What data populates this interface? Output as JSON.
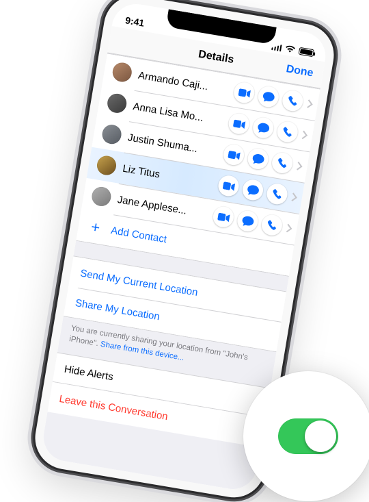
{
  "status": {
    "time": "9:41"
  },
  "nav": {
    "title": "Details",
    "done": "Done"
  },
  "contacts": [
    {
      "name": "Armando Caji...",
      "avatar": "c1",
      "highlight": false
    },
    {
      "name": "Anna Lisa Mo...",
      "avatar": "c2",
      "highlight": false
    },
    {
      "name": "Justin Shuma...",
      "avatar": "c3",
      "highlight": false
    },
    {
      "name": "Liz Titus",
      "avatar": "c4",
      "highlight": true
    },
    {
      "name": "Jane Applese...",
      "avatar": "c5",
      "highlight": false
    }
  ],
  "add_contact": "Add Contact",
  "location": {
    "send": "Send My Current Location",
    "share": "Share My Location",
    "note_prefix": "You are currently sharing your location from \"John's iPhone\". ",
    "note_link": "Share from this device..."
  },
  "hide_alerts": {
    "label": "Hide Alerts",
    "on": true
  },
  "leave": "Leave this Conversation",
  "colors": {
    "blue": "#0b6dff",
    "green": "#34c759",
    "red": "#ff3b30"
  },
  "icons": {
    "video": "video-icon",
    "message": "message-icon",
    "phone": "phone-icon",
    "wifi": "wifi-icon"
  }
}
